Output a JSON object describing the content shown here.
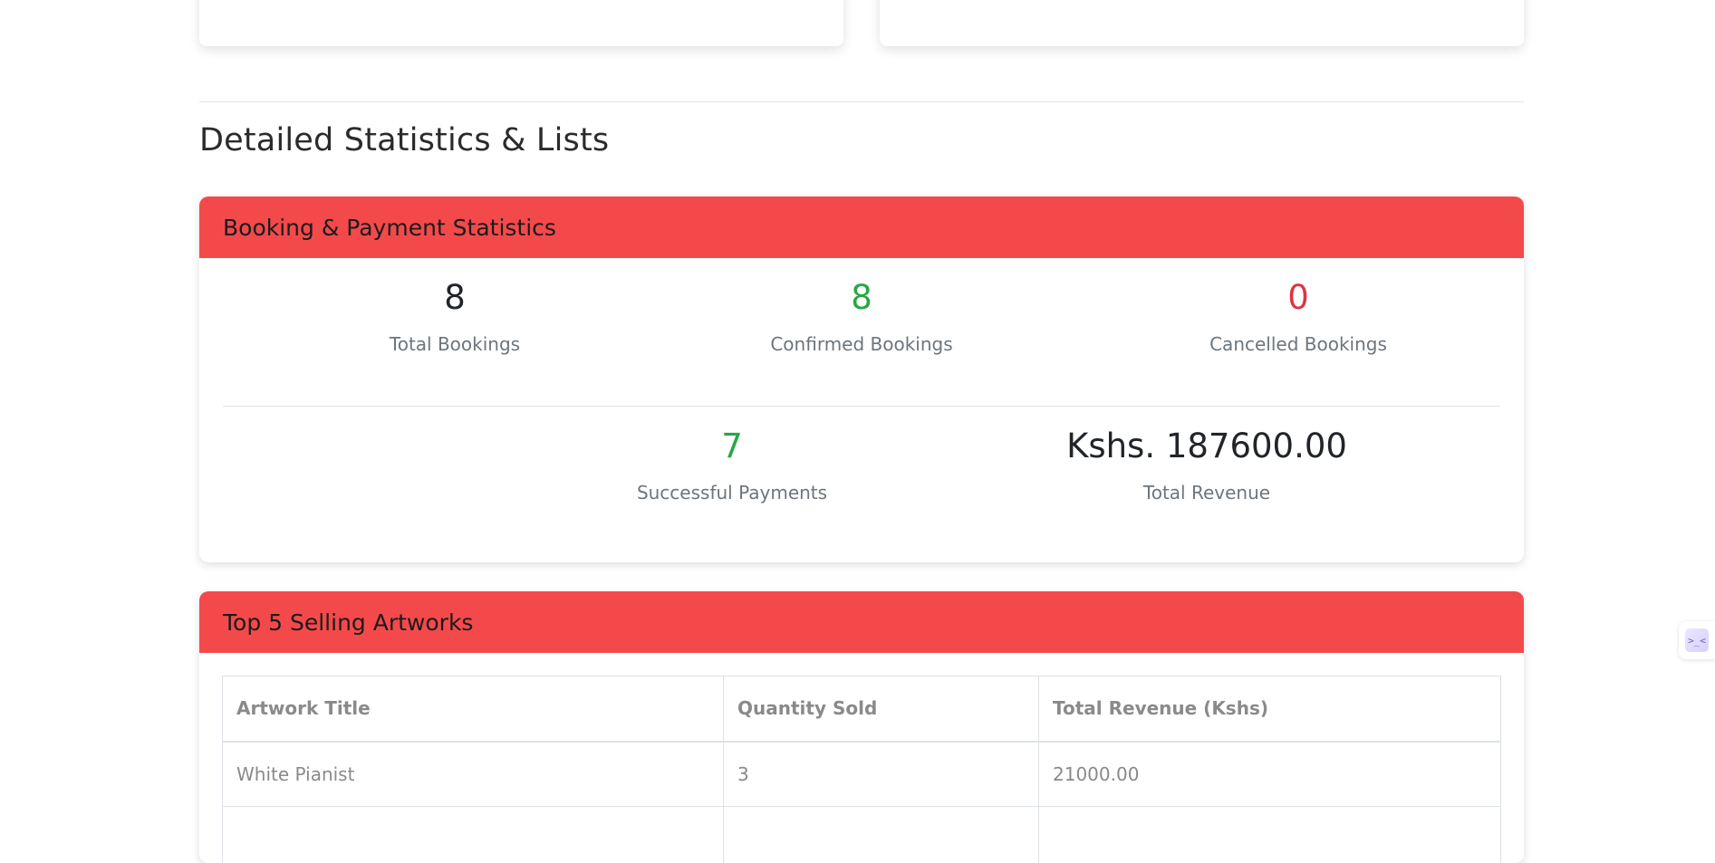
{
  "section_title": "Detailed Statistics & Lists",
  "booking_card": {
    "title": "Booking & Payment Statistics",
    "stats": [
      {
        "value": "8",
        "label": "Total Bookings"
      },
      {
        "value": "8",
        "label": "Confirmed Bookings"
      },
      {
        "value": "0",
        "label": "Cancelled Bookings"
      },
      {
        "value": "7",
        "label": "Successful Payments"
      },
      {
        "value": "Kshs. 187600.00",
        "label": "Total Revenue"
      }
    ]
  },
  "top_artworks_card": {
    "title": "Top 5 Selling Artworks",
    "columns": [
      "Artwork Title",
      "Quantity Sold",
      "Total Revenue (Kshs)"
    ],
    "rows": [
      [
        "White Pianist",
        "3",
        "21000.00"
      ],
      [
        "",
        "",
        ""
      ]
    ]
  },
  "widget": {
    "icon": "terminal-icon",
    "glyph": ">_<"
  },
  "colors": {
    "header_red": "#f4494b",
    "success_green": "#28a745",
    "danger_red": "#dc3545"
  }
}
